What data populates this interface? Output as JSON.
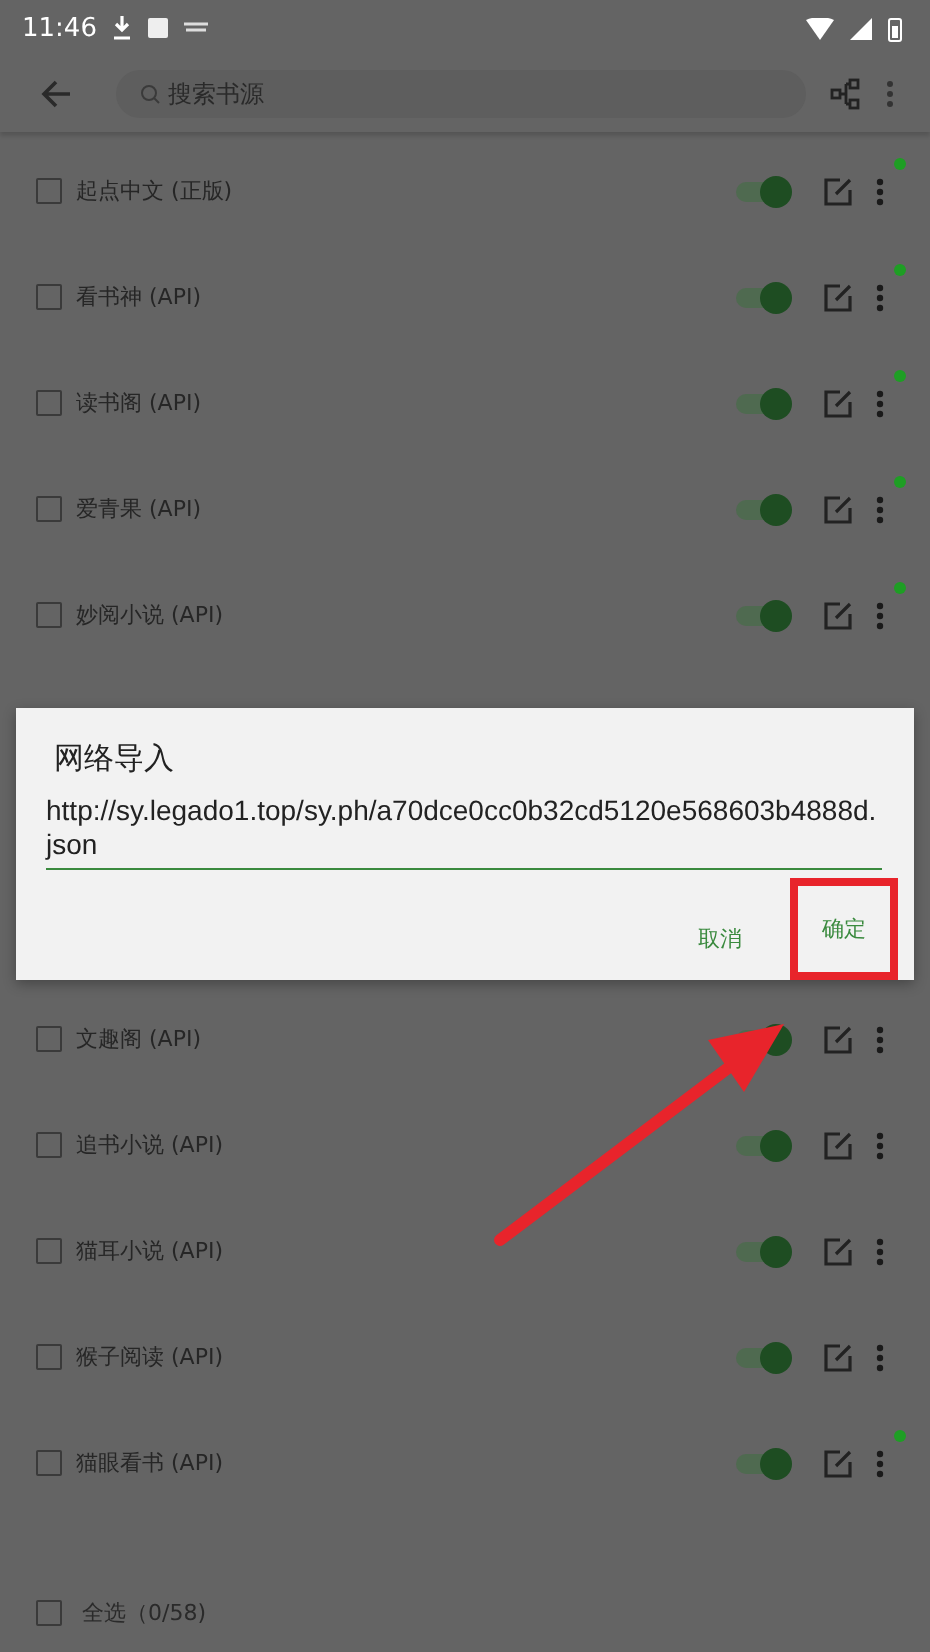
{
  "status_bar": {
    "time": "11:46"
  },
  "toolbar": {
    "search": {
      "placeholder": "搜索书源"
    }
  },
  "sources": [
    {
      "name": "起点中文 (正版)",
      "checked": false,
      "on": true,
      "dot": true
    },
    {
      "name": "看书神 (API)",
      "checked": false,
      "on": true,
      "dot": true
    },
    {
      "name": "读书阁 (API)",
      "checked": false,
      "on": true,
      "dot": true
    },
    {
      "name": "爱青果 (API)",
      "checked": false,
      "on": true,
      "dot": true
    },
    {
      "name": "妙阅小说 (API)",
      "checked": false,
      "on": true,
      "dot": true
    },
    {
      "name": "文趣阁 (API)",
      "checked": false,
      "on": true,
      "dot": false
    },
    {
      "name": "追书小说 (API)",
      "checked": false,
      "on": true,
      "dot": false
    },
    {
      "name": "猫耳小说 (API)",
      "checked": false,
      "on": true,
      "dot": false
    },
    {
      "name": "猴子阅读 (API)",
      "checked": false,
      "on": true,
      "dot": false
    },
    {
      "name": "猫眼看书 (API)",
      "checked": false,
      "on": true,
      "dot": true
    }
  ],
  "bottom_bar": {
    "select_all": {
      "label": "全选（0/58)",
      "checked": false
    }
  },
  "dialog": {
    "title": "网络导入",
    "value": "http://sy.legado1.top/sy.ph/a70dce0cc0b32cd5120e568603b4888d.json",
    "buttons": [
      {
        "label": "取消",
        "highlighted": false
      },
      {
        "label": "确定",
        "highlighted": true
      }
    ]
  }
}
